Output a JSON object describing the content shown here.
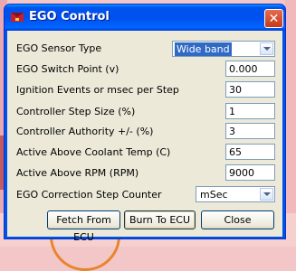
{
  "window": {
    "title": "EGO Control"
  },
  "fields": [
    {
      "label": "EGO Sensor Type",
      "type": "select",
      "value": "Wide band"
    },
    {
      "label": "EGO Switch Point (v)",
      "type": "text",
      "value": "0.000"
    },
    {
      "label": "Ignition Events or msec per Step",
      "type": "text",
      "value": "30"
    },
    {
      "label": "Controller Step Size (%)",
      "type": "text",
      "value": "1"
    },
    {
      "label": "Controller Authority +/- (%)",
      "type": "text",
      "value": "3"
    },
    {
      "label": "Active Above Coolant Temp (C)",
      "type": "text",
      "value": "65"
    },
    {
      "label": "Active Above RPM (RPM)",
      "type": "text",
      "value": "9000"
    },
    {
      "label": "EGO Correction Step Counter",
      "type": "select",
      "value": "mSec"
    }
  ],
  "buttons": {
    "fetch": "Fetch From ECU",
    "burn": "Burn To ECU",
    "close": "Close"
  },
  "colors": {
    "titlebar": "#0054e3",
    "dialog_bg": "#ece9d8",
    "selection": "#316ac5"
  }
}
